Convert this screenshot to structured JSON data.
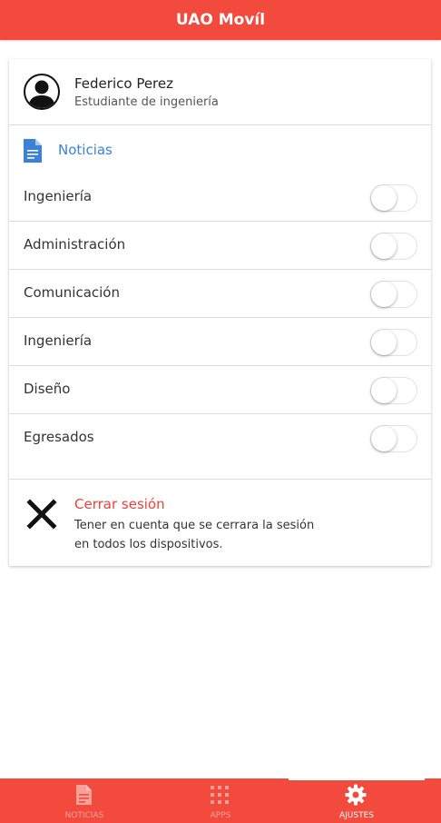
{
  "app": {
    "title": "UAO Movíl"
  },
  "profile": {
    "name": "Federico Perez",
    "role": "Estudiante de ingeniería",
    "avatar_icon": "user-avatar-icon"
  },
  "news_section": {
    "title": "Noticias",
    "icon": "document-icon"
  },
  "toggles": [
    {
      "label": "Ingeniería",
      "on": false
    },
    {
      "label": "Administración",
      "on": false
    },
    {
      "label": "Comunicación",
      "on": false
    },
    {
      "label": "Ingeniería",
      "on": false
    },
    {
      "label": "Diseño",
      "on": false
    },
    {
      "label": "Egresados",
      "on": false
    }
  ],
  "logout": {
    "title": "Cerrar sesión",
    "description": "Tener en cuenta que se cerrara la sesión en todos los dispositivos.",
    "icon": "close-icon"
  },
  "tabs": [
    {
      "label": "NOTICIAS",
      "icon": "document-icon",
      "active": false
    },
    {
      "label": "APPS",
      "icon": "grid-icon",
      "active": false
    },
    {
      "label": "AJUSTES",
      "icon": "gear-icon",
      "active": true
    }
  ],
  "colors": {
    "primary": "#f24a3d",
    "accent_blue": "#3b82d6",
    "logout_red": "#e8433a"
  }
}
